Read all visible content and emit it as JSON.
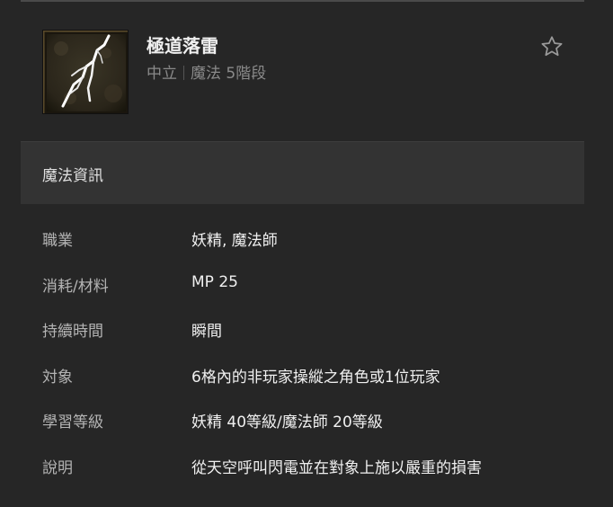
{
  "skill": {
    "name": "極道落雷",
    "alignment": "中立",
    "category": "魔法 5階段",
    "icon": "lightning-bolt-icon"
  },
  "favorite_icon": "star-outline-icon",
  "section": {
    "title": "魔法資訊"
  },
  "details": [
    {
      "label": "職業",
      "value": "妖精, 魔法師"
    },
    {
      "label": "消耗/材料",
      "value": "MP 25"
    },
    {
      "label": "持續時間",
      "value": "瞬間"
    },
    {
      "label": "対象",
      "value": "6格內的非玩家操縱之角色或1位玩家"
    },
    {
      "label": "學習等級",
      "value": "妖精 40等級/魔法師 20等級"
    },
    {
      "label": "說明",
      "value": "從天空呼叫閃電並在對象上施以嚴重的損害"
    }
  ],
  "colors": {
    "background": "#262626",
    "section_bg": "#333333",
    "text_primary": "#f0f0f0",
    "text_muted": "#8a8a8a"
  }
}
